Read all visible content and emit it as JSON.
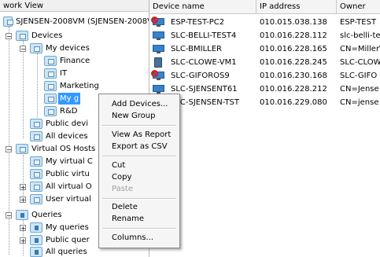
{
  "tree": {
    "header": "work View",
    "nodes": [
      {
        "label": "SJENSEN-2008VM (SJENSEN-2008VM)"
      },
      {
        "label": "Devices"
      },
      {
        "label": "My devices"
      },
      {
        "label": "Finance"
      },
      {
        "label": "IT"
      },
      {
        "label": "Marketing"
      },
      {
        "label": "My g"
      },
      {
        "label": "R&D"
      },
      {
        "label": "Public devi"
      },
      {
        "label": "All devices"
      },
      {
        "label": "Virtual OS Hosts"
      },
      {
        "label": "My virtual C"
      },
      {
        "label": "Public virtu"
      },
      {
        "label": "All virtual O"
      },
      {
        "label": "User virtual"
      },
      {
        "label": "Queries"
      },
      {
        "label": "My queries"
      },
      {
        "label": "Public quer"
      },
      {
        "label": "All queries"
      }
    ],
    "expanders": {
      "collapsed": "+",
      "expanded": "−"
    }
  },
  "list": {
    "columns": [
      "Device name",
      "IP address",
      "Owner"
    ],
    "rows": [
      {
        "name": "ESP-TEST-PC2",
        "ip": "010.015.038.138",
        "owner": "ESP-TEST",
        "icon": "monitor",
        "badge": "no-entry"
      },
      {
        "name": "SLC-BELLI-TEST4",
        "ip": "010.016.228.112",
        "owner": "slc-belli-te",
        "icon": "monitor",
        "badge": ""
      },
      {
        "name": "SLC-BMILLER",
        "ip": "010.016.228.165",
        "owner": "CN=Miller\\",
        "icon": "monitor",
        "badge": ""
      },
      {
        "name": "SLC-CLOWE-VM1",
        "ip": "010.016.228.245",
        "owner": "SLC-CLOW",
        "icon": "tower",
        "badge": ""
      },
      {
        "name": "SLC-GIFOROS9",
        "ip": "010.016.230.168",
        "owner": "SLC-GIFO",
        "icon": "monitor",
        "badge": "no-entry"
      },
      {
        "name": "SLC-SJENSENT61",
        "ip": "010.016.228.212",
        "owner": "CN=Jense",
        "icon": "monitor",
        "badge": ""
      },
      {
        "name": "SLC-SJENSEN-TST",
        "ip": "010.016.229.080",
        "owner": "CN=jense",
        "icon": "monitor",
        "badge": ""
      }
    ]
  },
  "context_menu": {
    "items": [
      {
        "label": "Add Devices...",
        "enabled": true
      },
      {
        "label": "New Group",
        "enabled": true
      },
      {
        "label": "View As Report",
        "enabled": true
      },
      {
        "label": "Export as CSV",
        "enabled": true
      },
      {
        "label": "Cut",
        "enabled": true
      },
      {
        "label": "Copy",
        "enabled": true
      },
      {
        "label": "Paste",
        "enabled": false
      },
      {
        "label": "Delete",
        "enabled": true
      },
      {
        "label": "Rename",
        "enabled": true
      },
      {
        "label": "Columns...",
        "enabled": true
      }
    ]
  },
  "colors": {
    "selection": "#3399ff",
    "header_bg": "#f4f4f4",
    "menu_bg": "#f5f5f5"
  }
}
